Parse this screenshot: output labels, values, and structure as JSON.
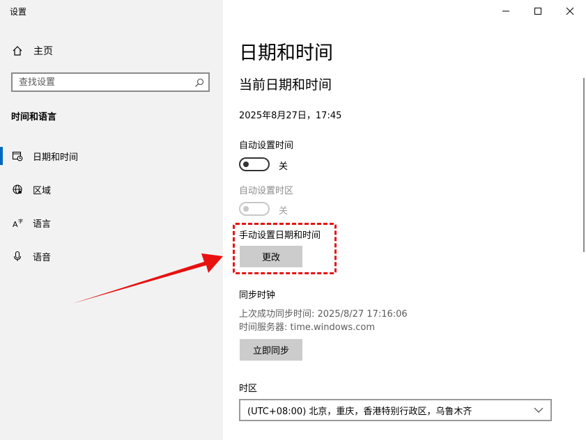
{
  "app": {
    "title": "设置"
  },
  "sidebar": {
    "home_label": "主页",
    "search_placeholder": "查找设置",
    "section_title": "时间和语言",
    "items": [
      {
        "label": "日期和时间",
        "icon": "calendar-clock-icon",
        "active": true
      },
      {
        "label": "区域",
        "icon": "globe-icon",
        "active": false
      },
      {
        "label": "语言",
        "icon": "language-icon",
        "active": false
      },
      {
        "label": "语音",
        "icon": "microphone-icon",
        "active": false
      }
    ]
  },
  "main": {
    "title": "日期和时间",
    "subtitle": "当前日期和时间",
    "current_datetime": "2025年8月27日，17:45",
    "auto_time": {
      "label": "自动设置时间",
      "state": "关"
    },
    "auto_timezone": {
      "label": "自动设置时区",
      "state": "关"
    },
    "manual": {
      "label": "手动设置日期和时间",
      "button": "更改"
    },
    "sync": {
      "label": "同步时钟",
      "last_sync": "上次成功同步时间: 2025/8/27 17:16:06",
      "server": "时间服务器: time.windows.com",
      "button": "立即同步"
    },
    "timezone": {
      "label": "时区",
      "value": "(UTC+08:00) 北京，重庆，香港特别行政区，乌鲁木齐"
    }
  },
  "colors": {
    "accent": "#0067c0",
    "annotation": "#e81010",
    "button_bg": "#cccccc",
    "sidebar_bg": "#f2f2f2"
  }
}
